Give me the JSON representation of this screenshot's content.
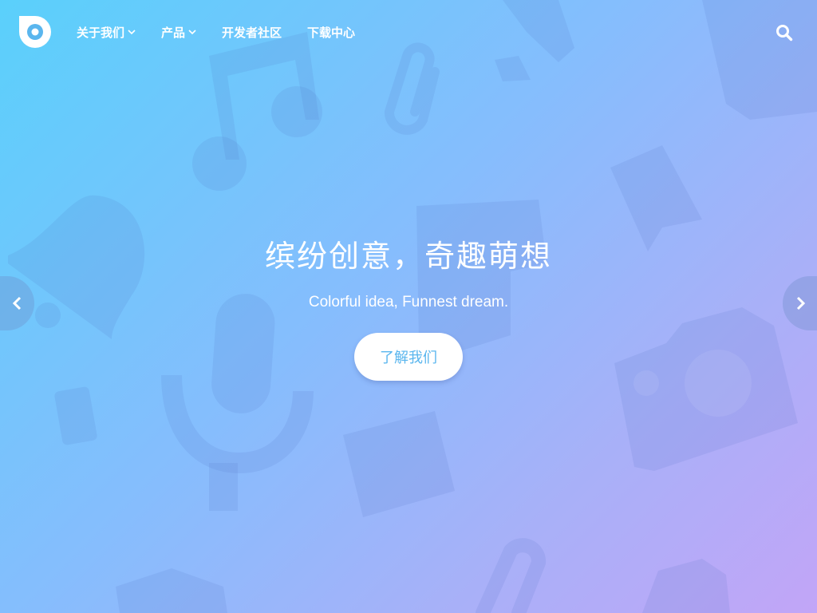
{
  "header": {
    "logo_icon": "logo-icon",
    "nav": [
      {
        "label": "关于我们",
        "has_dropdown": true
      },
      {
        "label": "产品",
        "has_dropdown": true
      },
      {
        "label": "开发者社区",
        "has_dropdown": false
      },
      {
        "label": "下载中心",
        "has_dropdown": false
      }
    ],
    "search_icon": "search-icon"
  },
  "hero": {
    "title": "缤纷创意，奇趣萌想",
    "subtitle": "Colorful idea, Funnest dream.",
    "button_label": "了解我们"
  },
  "carousel": {
    "prev_icon": "chevron-left-icon",
    "next_icon": "chevron-right-icon"
  },
  "colors": {
    "gradient_start": "#5ad0fb",
    "gradient_end": "#c2a5f7",
    "button_text": "#5ab6ee",
    "text": "#ffffff"
  }
}
